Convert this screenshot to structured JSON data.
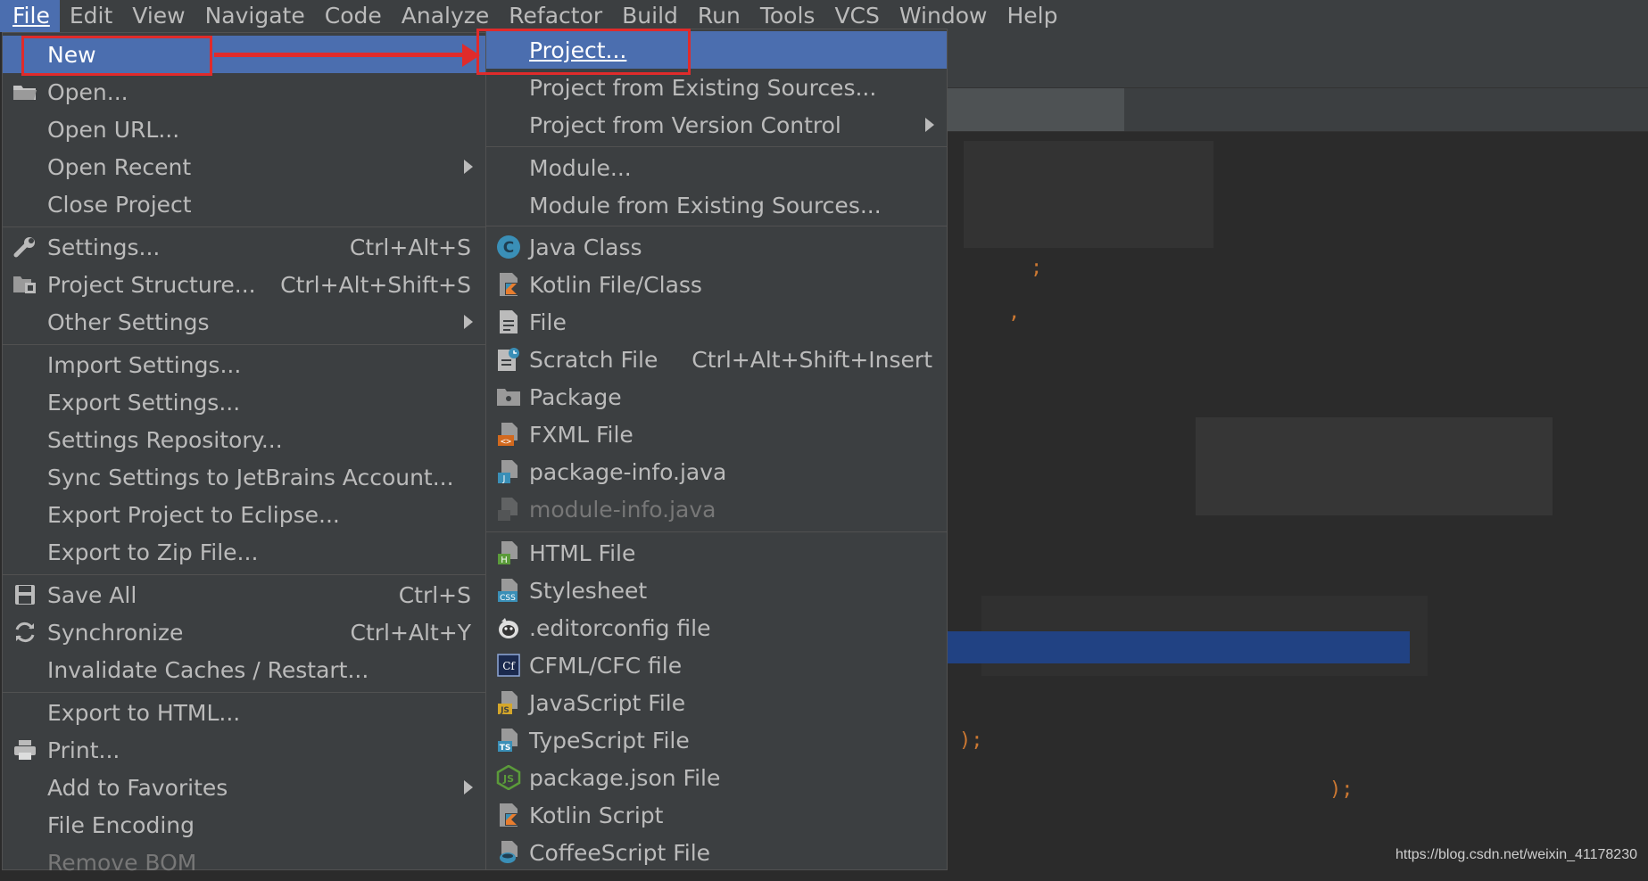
{
  "menubar": {
    "items": [
      "File",
      "Edit",
      "View",
      "Navigate",
      "Code",
      "Analyze",
      "Refactor",
      "Build",
      "Run",
      "Tools",
      "VCS",
      "Window",
      "Help"
    ]
  },
  "file_menu": {
    "new": "New",
    "open": "Open...",
    "open_url": "Open URL...",
    "open_recent": "Open Recent",
    "close_project": "Close Project",
    "settings": "Settings...",
    "settings_sc": "Ctrl+Alt+S",
    "project_structure": "Project Structure...",
    "project_structure_sc": "Ctrl+Alt+Shift+S",
    "other_settings": "Other Settings",
    "import_settings": "Import Settings...",
    "export_settings": "Export Settings...",
    "settings_repository": "Settings Repository...",
    "sync_settings": "Sync Settings to JetBrains Account...",
    "export_eclipse": "Export Project to Eclipse...",
    "export_zip": "Export to Zip File...",
    "save_all": "Save All",
    "save_all_sc": "Ctrl+S",
    "synchronize": "Synchronize",
    "synchronize_sc": "Ctrl+Alt+Y",
    "invalidate": "Invalidate Caches / Restart...",
    "export_html": "Export to HTML...",
    "print": "Print...",
    "add_favorites": "Add to Favorites",
    "file_encoding": "File Encoding",
    "remove_bom": "Remove BOM"
  },
  "new_menu": {
    "project": "Project...",
    "project_existing": "Project from Existing Sources...",
    "project_vcs": "Project from Version Control",
    "module": "Module...",
    "module_existing": "Module from Existing Sources...",
    "java_class": "Java Class",
    "kotlin_file": "Kotlin File/Class",
    "file": "File",
    "scratch_file": "Scratch File",
    "scratch_file_sc": "Ctrl+Alt+Shift+Insert",
    "package": "Package",
    "fxml_file": "FXML File",
    "package_info": "package-info.java",
    "module_info": "module-info.java",
    "html_file": "HTML File",
    "stylesheet": "Stylesheet",
    "editorconfig": ".editorconfig file",
    "cfml": "CFML/CFC file",
    "javascript": "JavaScript File",
    "typescript": "TypeScript File",
    "package_json": "package.json File",
    "kotlin_script": "Kotlin Script",
    "coffeescript": "CoffeeScript File"
  },
  "icons": {
    "open": "folder-icon",
    "settings": "wrench-icon",
    "project_structure": "project-structure-icon",
    "save_all": "save-icon",
    "synchronize": "sync-icon",
    "print": "printer-icon",
    "java_class": "java-class-icon",
    "kotlin_file": "kotlin-icon",
    "file": "file-icon",
    "scratch_file": "scratch-file-icon",
    "package": "package-folder-icon",
    "fxml": "fxml-icon",
    "package_info": "java-file-icon",
    "module_info": "java-file-icon",
    "html": "html-file-icon",
    "css": "css-file-icon",
    "editorconfig": "editorconfig-icon",
    "cfml": "cfml-icon",
    "js": "js-file-icon",
    "ts": "ts-file-icon",
    "node": "nodejs-icon",
    "kotlin_script": "kotlin-script-icon",
    "coffee": "coffeescript-icon"
  },
  "colors": {
    "selection": "#4b6eaf",
    "menu_bg": "#3c3f41",
    "text": "#bbbbbb",
    "annotation": "#e02b2b"
  },
  "watermark": "https://blog.csdn.net/weixin_41178230"
}
